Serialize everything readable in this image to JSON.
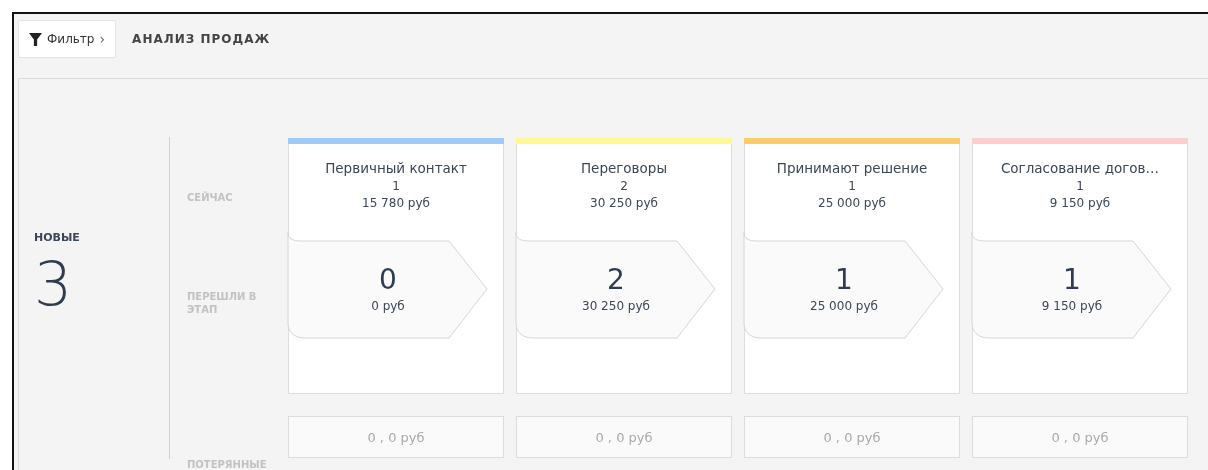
{
  "toolbar": {
    "filter_button": "Фильтр",
    "chevron": "›",
    "title": "АНАЛИЗ ПРОДАЖ"
  },
  "new_leads": {
    "label": "НОВЫЕ",
    "count": "3"
  },
  "row_labels": {
    "now": "СЕЙЧАС",
    "moved": "ПЕРЕШЛИ В ЭТАП",
    "lost": "ПОТЕРЯННЫЕ"
  },
  "stages": [
    {
      "name": "Первичный контакт",
      "color": "#9ccbf7",
      "count": "1",
      "amount": "15 780 руб",
      "moved_count": "0",
      "moved_amount": "0 руб",
      "lost": "0 , 0 руб"
    },
    {
      "name": "Переговоры",
      "color": "#fdfa96",
      "count": "2",
      "amount": "30 250 руб",
      "moved_count": "2",
      "moved_amount": "30 250 руб",
      "lost": "0 , 0 руб"
    },
    {
      "name": "Принимают решение",
      "color": "#fdca69",
      "count": "1",
      "amount": "25 000 руб",
      "moved_count": "1",
      "moved_amount": "25 000 руб",
      "lost": "0 , 0 руб"
    },
    {
      "name": "Согласование догов…",
      "color": "#fdcece",
      "count": "1",
      "amount": "9 150 руб",
      "moved_count": "1",
      "moved_amount": "9 150 руб",
      "lost": "0 , 0 руб"
    }
  ]
}
